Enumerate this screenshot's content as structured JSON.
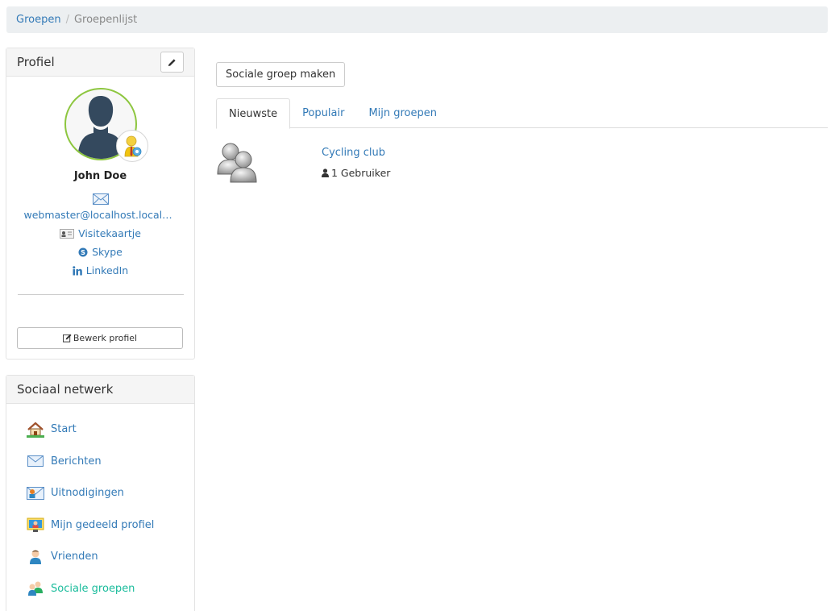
{
  "breadcrumb": {
    "root": "Groepen",
    "separator": "/",
    "current": "Groepenlijst"
  },
  "profile": {
    "title": "Profiel",
    "name": "John Doe",
    "email": "webmaster@localhost.localdomain",
    "visit_card": "Visitekaartje",
    "skype": "Skype",
    "linkedin": "LinkedIn",
    "edit_label": "Bewerk profiel",
    "avatar_border_color": "#8dc63f"
  },
  "social": {
    "title": "Sociaal netwerk",
    "items": [
      {
        "label": "Start",
        "icon": "home-icon"
      },
      {
        "label": "Berichten",
        "icon": "envelope-icon"
      },
      {
        "label": "Uitnodigingen",
        "icon": "invitation-icon"
      },
      {
        "label": "Mijn gedeeld profiel",
        "icon": "shared-profile-icon"
      },
      {
        "label": "Vrienden",
        "icon": "friend-icon"
      },
      {
        "label": "Sociale groepen",
        "icon": "groups-icon",
        "active": true
      }
    ],
    "active_color": "#1abc9c"
  },
  "main": {
    "create_button": "Sociale groep maken",
    "tabs": [
      "Nieuwste",
      "Populair",
      "Mijn groepen"
    ],
    "groups": [
      {
        "name": "Cycling club",
        "members": "1 Gebruiker"
      }
    ]
  }
}
